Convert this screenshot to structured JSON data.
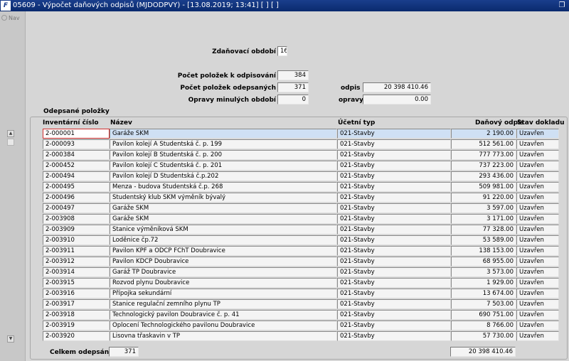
{
  "window": {
    "title": "05609 - Výpočet daňových odpisů (MJDODPVY) - [13.08.2019; 13:41]  [ ]  [ ]",
    "icon_glyph": "F",
    "restore_glyph": "❐"
  },
  "toolbar": {
    "nav_label": "Nav"
  },
  "form": {
    "period_label": "Zdaňovací období",
    "period_value": "16",
    "count_to_depreciate_label": "Počet položek k odpisování",
    "count_to_depreciate_value": "384",
    "count_depreciated_label": "Počet položek odepsaných",
    "count_depreciated_value": "371",
    "depreciation_label": "odpis",
    "depreciation_value": "20 398 410.46",
    "corrections_label": "Opravy minulých období",
    "corrections_value": "0",
    "corrections_amount_label": "opravy",
    "corrections_amount_value": "0.00"
  },
  "table": {
    "group_title": "Odepsané položky",
    "headers": {
      "inv": "Inventární číslo",
      "name": "Název",
      "type": "Účetní typ",
      "tax": "Daňový odpis",
      "status": "Stav dokladu"
    },
    "rows": [
      {
        "inv": "2-000001",
        "name": "Garáže SKM",
        "type": "021-Stavby",
        "tax": "2 190.00",
        "status": "Uzavřen"
      },
      {
        "inv": "2-000093",
        "name": "Pavilon kolejí A Studentská č. p. 199",
        "type": "021-Stavby",
        "tax": "512 561.00",
        "status": "Uzavřen"
      },
      {
        "inv": "2-000384",
        "name": "Pavilon kolejí B Studentská č. p. 200",
        "type": "021-Stavby",
        "tax": "777 773.00",
        "status": "Uzavřen"
      },
      {
        "inv": "2-000452",
        "name": "Pavilon kolejí C Studentská č. p. 201",
        "type": "021-Stavby",
        "tax": "737 223.00",
        "status": "Uzavřen"
      },
      {
        "inv": "2-000494",
        "name": "Pavilon kolejí D Studentská č.p.202",
        "type": "021-Stavby",
        "tax": "293 436.00",
        "status": "Uzavřen"
      },
      {
        "inv": "2-000495",
        "name": "Menza - budova Studentská č.p. 268",
        "type": "021-Stavby",
        "tax": "509 981.00",
        "status": "Uzavřen"
      },
      {
        "inv": "2-000496",
        "name": "Studentský klub SKM výměník bývalý",
        "type": "021-Stavby",
        "tax": "91 220.00",
        "status": "Uzavřen"
      },
      {
        "inv": "2-000497",
        "name": "Garáže SKM",
        "type": "021-Stavby",
        "tax": "3 597.00",
        "status": "Uzavřen"
      },
      {
        "inv": "2-003908",
        "name": "Garáže SKM",
        "type": "021-Stavby",
        "tax": "3 171.00",
        "status": "Uzavřen"
      },
      {
        "inv": "2-003909",
        "name": "Stanice výměníková SKM",
        "type": "021-Stavby",
        "tax": "77 328.00",
        "status": "Uzavřen"
      },
      {
        "inv": "2-003910",
        "name": "Loděnice čp.72",
        "type": "021-Stavby",
        "tax": "53 589.00",
        "status": "Uzavřen"
      },
      {
        "inv": "2-003911",
        "name": "Pavilon KPF a ODCP FChT Doubravice",
        "type": "021-Stavby",
        "tax": "138 153.00",
        "status": "Uzavřen"
      },
      {
        "inv": "2-003912",
        "name": "Pavilon KDCP Doubravice",
        "type": "021-Stavby",
        "tax": "68 955.00",
        "status": "Uzavřen"
      },
      {
        "inv": "2-003914",
        "name": "Garáž TP Doubravice",
        "type": "021-Stavby",
        "tax": "3 573.00",
        "status": "Uzavřen"
      },
      {
        "inv": "2-003915",
        "name": "Rozvod plynu Doubravice",
        "type": "021-Stavby",
        "tax": "1 929.00",
        "status": "Uzavřen"
      },
      {
        "inv": "2-003916",
        "name": "Přípojka sekundární",
        "type": "021-Stavby",
        "tax": "13 674.00",
        "status": "Uzavřen"
      },
      {
        "inv": "2-003917",
        "name": "Stanice regulační zemního plynu TP",
        "type": "021-Stavby",
        "tax": "7 503.00",
        "status": "Uzavřen"
      },
      {
        "inv": "2-003918",
        "name": "Technologický pavilon Doubravice č. p. 41",
        "type": "021-Stavby",
        "tax": "690 751.00",
        "status": "Uzavřen"
      },
      {
        "inv": "2-003919",
        "name": "Oplocení Technologického pavilonu Doubravice",
        "type": "021-Stavby",
        "tax": "8 766.00",
        "status": "Uzavřen"
      },
      {
        "inv": "2-003920",
        "name": "Lisovna třaskavin v TP",
        "type": "021-Stavby",
        "tax": "57 730.00",
        "status": "Uzavřen"
      }
    ],
    "selected_index": 0,
    "total_label": "Celkem odepsáno",
    "total_count": "371",
    "total_amount": "20 398 410.46",
    "scroll_up_glyph": "▲",
    "scroll_down_glyph": "▼"
  }
}
